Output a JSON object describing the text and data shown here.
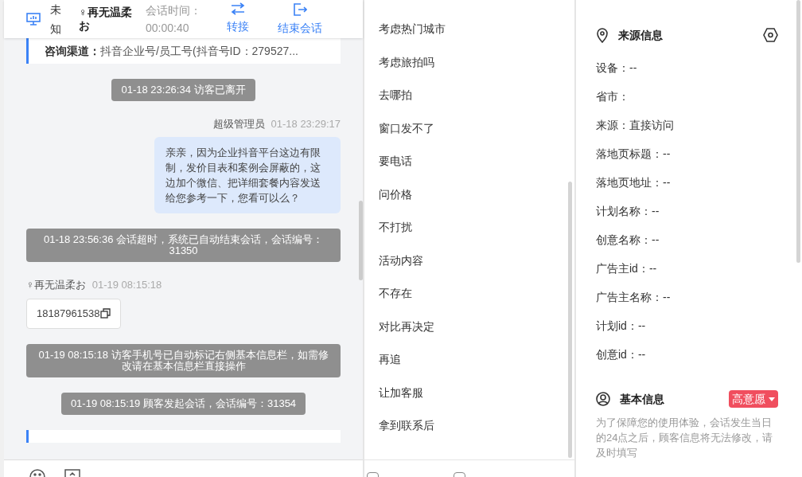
{
  "header": {
    "device": "未知",
    "visitor": "♀再无温柔お",
    "timer_label": "会话时间：",
    "timer": "00:00:40",
    "actions": [
      {
        "kind": "transfer",
        "label": "转接"
      },
      {
        "kind": "end",
        "label": "结束会话"
      }
    ]
  },
  "messages": [
    {
      "kind": "channel",
      "label": "咨询渠道：",
      "text": "抖音企业号/员工号(抖音号ID：279527..."
    },
    {
      "kind": "system",
      "text": "01-18 23:26:34 访客已离开"
    },
    {
      "kind": "agent",
      "sender": "超级管理员",
      "time": "01-18 23:29:17",
      "text": "亲亲，因为企业抖音平台这边有限制，发价目表和案例会屏蔽的，这边加个微信、把详细套餐内容发送给您参考一下，您看可以么？"
    },
    {
      "kind": "system",
      "text": "01-18 23:56:36 会话超时，系统已自动结束会话，会话编号：31350"
    },
    {
      "kind": "visitor",
      "sender": "♀再无温柔お",
      "time": "01-19 08:15:18",
      "text": "18187961538"
    },
    {
      "kind": "system",
      "text": "01-19 08:15:18 访客手机号已自动标记右侧基本信息栏，如需修改请在基本信息栏直接操作"
    },
    {
      "kind": "system",
      "text": "01-19 08:15:19 顾客发起会话，会话编号：31354"
    },
    {
      "kind": "channel_cut"
    }
  ],
  "composer": {
    "checkboxes": [
      {
        "checked": false
      },
      {
        "checked": false
      }
    ]
  },
  "quick_replies": [
    "考虑热门城市",
    "考虑旅拍吗",
    "去哪拍",
    "窗口发不了",
    "要电话",
    "问价格",
    "不打扰",
    "活动内容",
    "不存在",
    "对比再决定",
    "再追",
    "让加客服",
    "拿到联系后"
  ],
  "source_info": {
    "title": "来源信息",
    "rows": [
      "设备：--",
      "省市：",
      "来源：直接访问",
      "落地页标题：--",
      "落地页地址：--",
      "计划名称：--",
      "创意名称：--",
      "广告主id：--",
      "广告主名称：--",
      "计划id：--",
      "创意id：--"
    ]
  },
  "basic_info": {
    "title": "基本信息",
    "intent": "高意愿",
    "note": "为了保障您的使用体验，会话发生当日的24点之后，顾客信息将无法修改，请及时填写"
  }
}
